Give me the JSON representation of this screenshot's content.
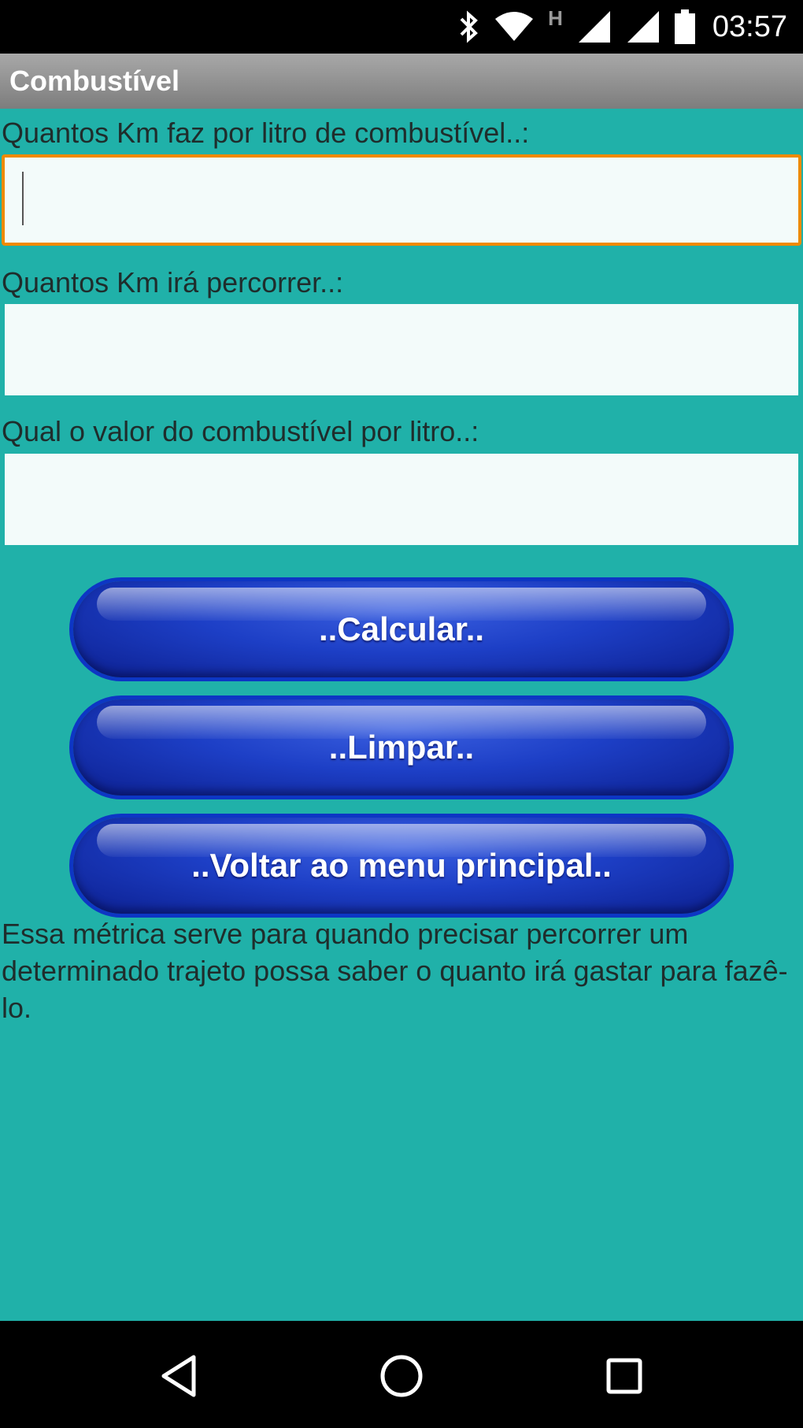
{
  "status_bar": {
    "time": "03:57",
    "network_label": "H",
    "icons": [
      "bluetooth-icon",
      "wifi-icon",
      "signal-icon",
      "signal-icon",
      "battery-icon"
    ]
  },
  "app": {
    "title": "Combustível"
  },
  "form": {
    "km_per_liter": {
      "label": "Quantos Km faz por litro de combustível..:",
      "value": "",
      "placeholder": ""
    },
    "distance": {
      "label": "Quantos Km irá percorrer..:",
      "value": "",
      "placeholder": ""
    },
    "fuel_price": {
      "label": "Qual o valor do combustível por litro..:",
      "value": "",
      "placeholder": ""
    }
  },
  "buttons": {
    "calculate": "..Calcular..",
    "clear": "..Limpar..",
    "back": "..Voltar ao menu principal.."
  },
  "description": "Essa métrica serve para quando precisar percorrer um determinado trajeto possa saber o quanto irá gastar para fazê-lo.",
  "nav_bar": {
    "icons": [
      "back-icon",
      "home-icon",
      "recents-icon"
    ]
  },
  "colors": {
    "background": "#20b1a9",
    "focus_border": "#f08a00",
    "button_blue": "#1d3fc6",
    "title_bar": "#8f8f8f"
  }
}
